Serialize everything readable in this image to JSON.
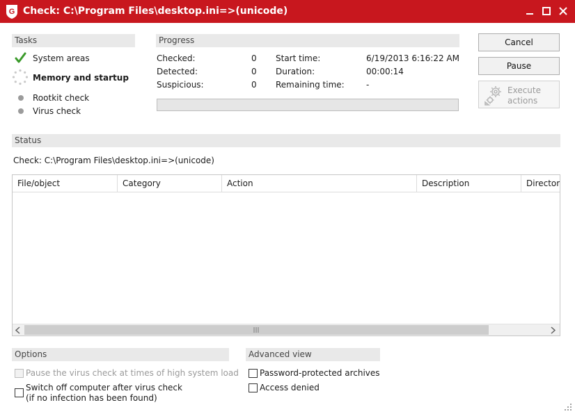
{
  "window": {
    "title": "Check: C:\\Program Files\\desktop.ini=>(unicode)",
    "accent": "#c8171e"
  },
  "tasks": {
    "header": "Tasks",
    "items": [
      {
        "label": "System areas",
        "state": "done",
        "icon": "checkmark-icon"
      },
      {
        "label": "Memory and startup",
        "state": "running",
        "icon": "spinner-icon"
      },
      {
        "label": "Rootkit check",
        "state": "pending",
        "icon": "pending-dot-icon"
      },
      {
        "label": "Virus check",
        "state": "pending",
        "icon": "pending-dot-icon"
      }
    ]
  },
  "progress": {
    "header": "Progress",
    "checked_label": "Checked:",
    "checked_value": "0",
    "detected_label": "Detected:",
    "detected_value": "0",
    "suspicious_label": "Suspicious:",
    "suspicious_value": "0",
    "start_label": "Start time:",
    "start_value": "6/19/2013 6:16:22 AM",
    "duration_label": "Duration:",
    "duration_value": "00:00:14",
    "remaining_label": "Remaining time:",
    "remaining_value": "-",
    "bar_fraction": 0
  },
  "actions": {
    "cancel": "Cancel",
    "pause": "Pause",
    "execute_line1": "Execute",
    "execute_line2": "actions"
  },
  "status": {
    "header": "Status",
    "text": "Check: C:\\Program Files\\desktop.ini=>(unicode)"
  },
  "table": {
    "columns": [
      "File/object",
      "Category",
      "Action",
      "Description",
      "Directory"
    ],
    "rows": []
  },
  "options": {
    "header": "Options",
    "pause_label": "Pause the virus check at times of high system load",
    "pause_enabled": false,
    "switchoff_line1": "Switch off computer after virus check",
    "switchoff_line2": "(if no infection has been found)"
  },
  "advanced": {
    "header": "Advanced view",
    "password_label": "Password-protected archives",
    "access_label": "Access denied"
  }
}
